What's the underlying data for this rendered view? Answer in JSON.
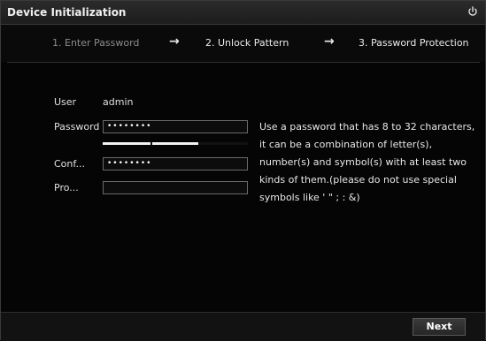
{
  "window": {
    "title": "Device Initialization",
    "power_icon": "power-icon"
  },
  "steps": [
    {
      "label": "1.  Enter Password",
      "state": "active"
    },
    {
      "label": "2.  Unlock Pattern",
      "state": "pending"
    },
    {
      "label": "3.  Password Protection",
      "state": "pending"
    }
  ],
  "step_arrow": "→",
  "form": {
    "user_label": "User",
    "user_value": "admin",
    "password_label": "Password",
    "password_value": "••••••••",
    "confirm_label": "Conf...",
    "confirm_value": "••••••••",
    "protection_label": "Pro...",
    "protection_value": ""
  },
  "hint": "Use a password that has 8 to 32 characters, it can be a combination of letter(s), number(s) and symbol(s) with at least two kinds of them.(please do not use special symbols like ' \" ; : &)",
  "strength_level": 0.67,
  "footer": {
    "next_label": "Next"
  },
  "colors": {
    "background": "#050505",
    "titlebar": "#262626",
    "text": "#e6e6e6",
    "active_step": "#8c8c8c"
  }
}
